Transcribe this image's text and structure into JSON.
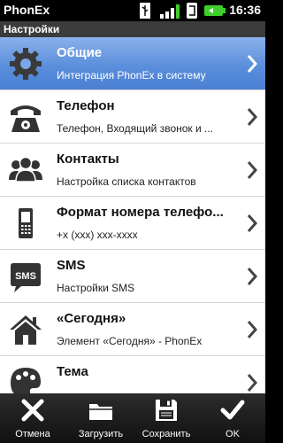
{
  "statusbar": {
    "app_name": "PhonEx",
    "time": "16:36"
  },
  "header": {
    "title": "Настройки"
  },
  "items": [
    {
      "title": "Общие",
      "subtitle": "Интеграция PhonEx в систему",
      "icon": "gear-icon",
      "selected": true
    },
    {
      "title": "Телефон",
      "subtitle": "Телефон, Входящий звонок и ...",
      "icon": "telephone-icon"
    },
    {
      "title": "Контакты",
      "subtitle": "Настройка списка контактов",
      "icon": "contacts-icon"
    },
    {
      "title": "Формат номера телефо...",
      "subtitle": "+x (xxx) xxx-xxxx",
      "icon": "mobile-phone-icon"
    },
    {
      "title": "SMS",
      "subtitle": "Настройки SMS",
      "icon": "sms-icon",
      "icon_text": "SMS"
    },
    {
      "title": "«Сегодня»",
      "subtitle": "Элемент «Сегодня» - PhonEx",
      "icon": "home-icon"
    },
    {
      "title": "Тема",
      "subtitle": "",
      "icon": "palette-icon"
    }
  ],
  "toolbar": {
    "cancel": "Отмена",
    "load": "Загрузить",
    "save": "Сохранить",
    "ok": "OK"
  },
  "colors": {
    "selected_top": "#8ab1ea",
    "selected_bottom": "#4a7fd3",
    "battery": "#3fcf2b"
  }
}
